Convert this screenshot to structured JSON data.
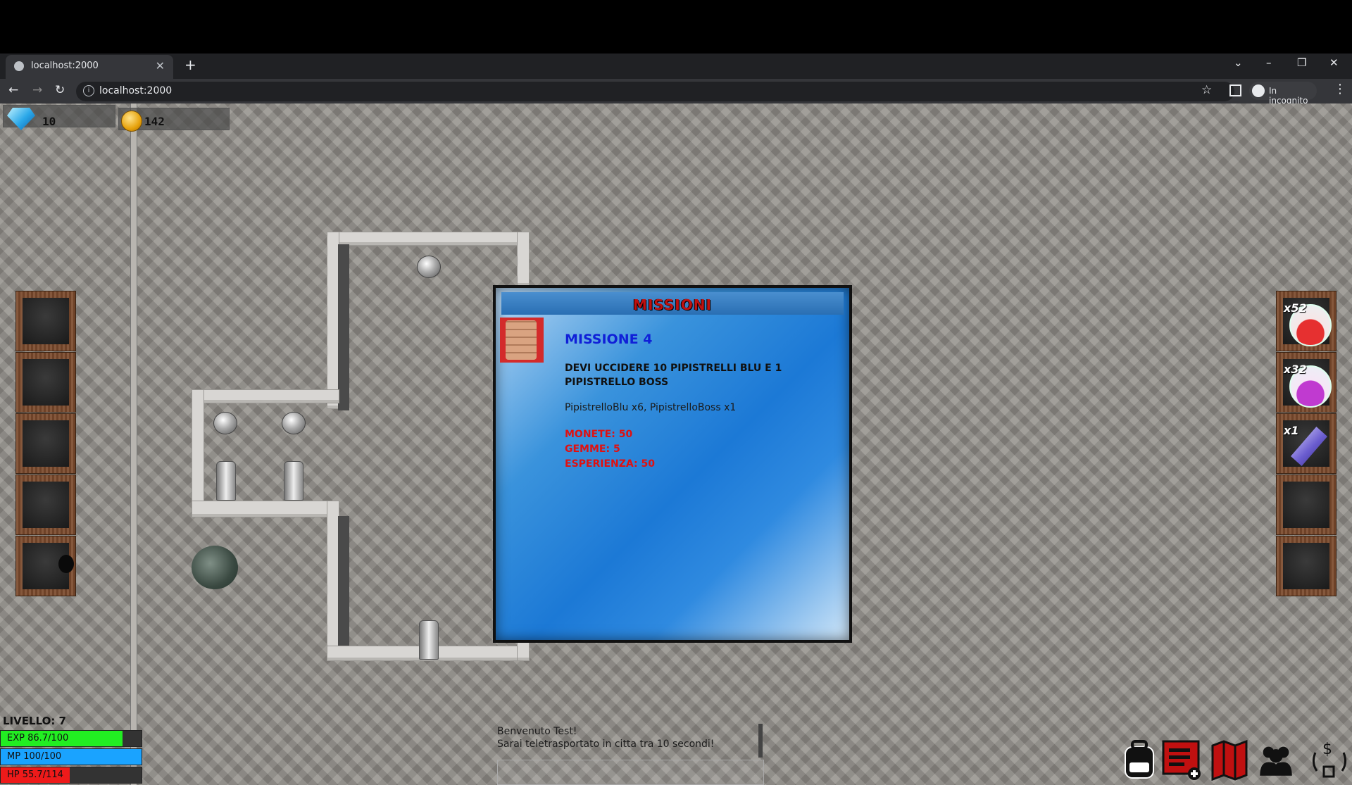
{
  "browser": {
    "tab_title": "localhost:2000",
    "url": "localhost:2000",
    "incognito_label": "In incognito"
  },
  "hud": {
    "gems": "10",
    "coins": "142"
  },
  "inventory_left": [
    "",
    "",
    "",
    "",
    ""
  ],
  "inventory_right": [
    {
      "qty": "x52",
      "item": "red-potion"
    },
    {
      "qty": "x32",
      "item": "purple-potion"
    },
    {
      "qty": "x1",
      "item": "crystal"
    },
    {
      "qty": "",
      "item": ""
    },
    {
      "qty": "",
      "item": ""
    }
  ],
  "missions": {
    "header": "MISSIONI",
    "name": "MISSIONE 4",
    "description": "DEVI UCCIDERE 10 PIPISTRELLI BLU E 1 PIPISTRELLO BOSS",
    "targets": "PipistrelloBlu x6, PipistrelloBoss x1",
    "rewards": {
      "coins": "MONETE: 50",
      "gems": "GEMME: 5",
      "exp": "ESPERIENZA: 50"
    }
  },
  "chat": {
    "line1": "Benvenuto Test!",
    "line2": "Sarai teletrasportato in citta tra 10 secondi!"
  },
  "player": {
    "level": "LIVELLO: 7",
    "exp": {
      "text": "EXP 86.7/100",
      "fraction": 0.867,
      "color": "#22ee22"
    },
    "mp": {
      "text": "MP 100/100",
      "fraction": 1.0,
      "color": "#1aa3ff"
    },
    "hp": {
      "text": "HP 55.7/114",
      "fraction": 0.489,
      "color": "#ee1a1a"
    }
  },
  "toolbar": [
    "backpack-icon",
    "quest-list-icon",
    "map-icon",
    "party-icon",
    "currency-exchange-icon"
  ]
}
